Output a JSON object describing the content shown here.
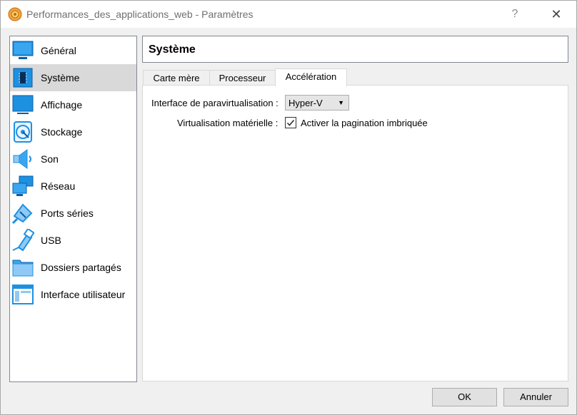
{
  "window": {
    "title": "Performances_des_applications_web - Paramètres",
    "help_label": "?",
    "close_label": "✕"
  },
  "sidebar": {
    "items": [
      {
        "label": "Général",
        "icon": "monitor-icon"
      },
      {
        "label": "Système",
        "icon": "chip-icon",
        "selected": true
      },
      {
        "label": "Affichage",
        "icon": "display-icon"
      },
      {
        "label": "Stockage",
        "icon": "disk-icon"
      },
      {
        "label": "Son",
        "icon": "speaker-icon"
      },
      {
        "label": "Réseau",
        "icon": "network-icon"
      },
      {
        "label": "Ports séries",
        "icon": "serial-port-icon"
      },
      {
        "label": "USB",
        "icon": "usb-icon"
      },
      {
        "label": "Dossiers partagés",
        "icon": "folder-icon"
      },
      {
        "label": "Interface utilisateur",
        "icon": "window-icon"
      }
    ]
  },
  "page": {
    "title": "Système",
    "tabs": [
      {
        "label": "Carte mère"
      },
      {
        "label": "Processeur"
      },
      {
        "label": "Accélération",
        "active": true
      }
    ]
  },
  "acceleration": {
    "paravirt_label": "Interface de paravirtualisation :",
    "paravirt_value": "Hyper-V",
    "hwvirt_label": "Virtualisation matérielle :",
    "nested_paging_label": "Activer la pagination imbriquée",
    "nested_paging_checked": true
  },
  "buttons": {
    "ok": "OK",
    "cancel": "Annuler"
  },
  "colors": {
    "accent": "#1e90e0",
    "selection": "#d9d9d9"
  }
}
